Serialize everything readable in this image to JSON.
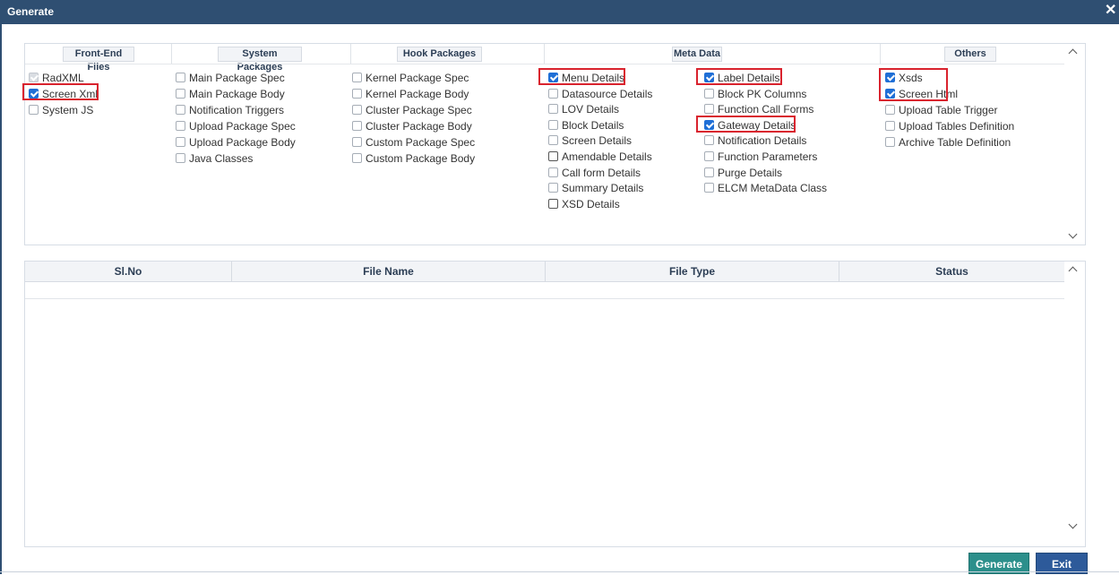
{
  "dialog": {
    "title": "Generate"
  },
  "options": {
    "headers": [
      "Front-End Files",
      "System Packages",
      "Hook Packages",
      "Meta Data",
      "Others"
    ],
    "front_end": [
      {
        "label": "RadXML",
        "state": "disabled"
      },
      {
        "label": "Screen Xml",
        "state": "checked"
      },
      {
        "label": "System JS",
        "state": "unchecked"
      }
    ],
    "system_packages": [
      {
        "label": "Main Package Spec",
        "state": "unchecked"
      },
      {
        "label": "Main Package Body",
        "state": "unchecked"
      },
      {
        "label": "Notification Triggers",
        "state": "unchecked"
      },
      {
        "label": "Upload Package Spec",
        "state": "unchecked"
      },
      {
        "label": "Upload Package Body",
        "state": "unchecked"
      },
      {
        "label": "Java Classes",
        "state": "unchecked"
      }
    ],
    "hook_packages": [
      {
        "label": "Kernel Package Spec",
        "state": "unchecked"
      },
      {
        "label": "Kernel Package Body",
        "state": "unchecked"
      },
      {
        "label": "Cluster Package Spec",
        "state": "unchecked"
      },
      {
        "label": "Cluster Package Body",
        "state": "unchecked"
      },
      {
        "label": "Custom Package Spec",
        "state": "unchecked"
      },
      {
        "label": "Custom Package Body",
        "state": "unchecked"
      }
    ],
    "meta_data_left": [
      {
        "label": "Menu Details",
        "state": "checked"
      },
      {
        "label": "Datasource Details",
        "state": "unchecked"
      },
      {
        "label": "LOV Details",
        "state": "unchecked"
      },
      {
        "label": "Block Details",
        "state": "unchecked"
      },
      {
        "label": "Screen Details",
        "state": "unchecked"
      },
      {
        "label": "Amendable Details",
        "state": "unchecked"
      },
      {
        "label": "Call form Details",
        "state": "unchecked"
      },
      {
        "label": "Summary Details",
        "state": "unchecked"
      },
      {
        "label": "XSD Details",
        "state": "unchecked"
      }
    ],
    "meta_data_right": [
      {
        "label": "Label Details",
        "state": "checked"
      },
      {
        "label": "Block PK Columns",
        "state": "unchecked"
      },
      {
        "label": "Function Call Forms",
        "state": "unchecked"
      },
      {
        "label": "Gateway Details",
        "state": "checked"
      },
      {
        "label": "Notification Details",
        "state": "unchecked"
      },
      {
        "label": "Function Parameters",
        "state": "unchecked"
      },
      {
        "label": "Purge Details",
        "state": "unchecked"
      },
      {
        "label": "ELCM MetaData Class",
        "state": "unchecked"
      }
    ],
    "others": [
      {
        "label": "Xsds",
        "state": "checked"
      },
      {
        "label": "Screen Html",
        "state": "checked"
      },
      {
        "label": "Upload Table Trigger",
        "state": "unchecked"
      },
      {
        "label": "Upload Tables Definition",
        "state": "unchecked"
      },
      {
        "label": "Archive Table Definition",
        "state": "unchecked"
      }
    ]
  },
  "files_table": {
    "columns": [
      "Sl.No",
      "File Name",
      "File Type",
      "Status"
    ],
    "rows": []
  },
  "buttons": {
    "generate": "Generate",
    "exit": "Exit"
  },
  "colors": {
    "title_bar": "#2f4f72",
    "highlight": "#d9232e",
    "checkbox_checked": "#1f6fd6",
    "generate_button": "#2c8f8b",
    "exit_button": "#2d5a9a"
  }
}
